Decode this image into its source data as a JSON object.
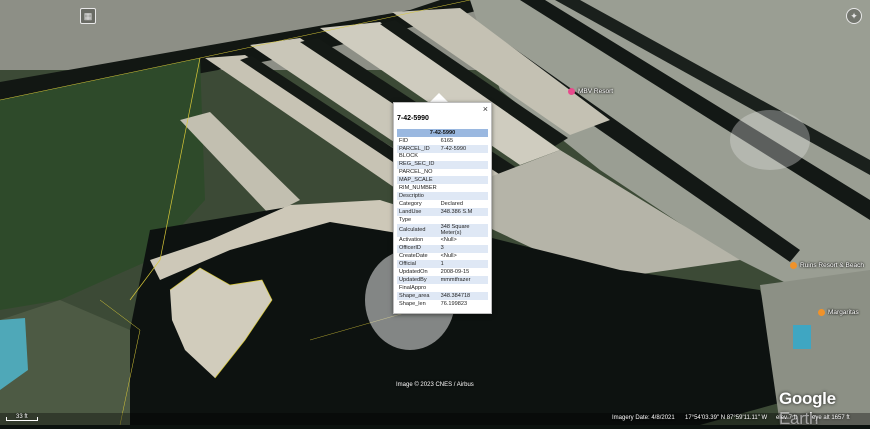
{
  "balloon": {
    "title": "7-42-5990",
    "table_header": "7-42-5990",
    "rows": [
      {
        "key": "FID",
        "value": "6165"
      },
      {
        "key": "PARCEL_ID",
        "value": "7-42-5990"
      },
      {
        "key": "BLOCK",
        "value": ""
      },
      {
        "key": "REG_SEC_ID",
        "value": ""
      },
      {
        "key": "PARCEL_NO",
        "value": ""
      },
      {
        "key": "MAP_SCALE",
        "value": ""
      },
      {
        "key": "RIM_NUMBER",
        "value": ""
      },
      {
        "key": "Descriptio",
        "value": ""
      },
      {
        "key": "Category",
        "value": "Declared"
      },
      {
        "key": "LandUse",
        "value": "348.386 S.M"
      },
      {
        "key": "Type",
        "value": ""
      },
      {
        "key": "Calculated",
        "value": "348 Square Meter(s)"
      },
      {
        "key": "Activation",
        "value": "<Null>"
      },
      {
        "key": "OfficerID",
        "value": "3"
      },
      {
        "key": "CreateDate",
        "value": "<Null>"
      },
      {
        "key": "Official",
        "value": "1"
      },
      {
        "key": "UpdatedOn",
        "value": "2008-09-15"
      },
      {
        "key": "UpdatedBy",
        "value": "mmmtfrazer"
      },
      {
        "key": "FinalAppro",
        "value": ""
      },
      {
        "key": "Shape_area",
        "value": "348.384718"
      },
      {
        "key": "Shape_len",
        "value": "76.199823"
      }
    ],
    "close_glyph": "×"
  },
  "map": {
    "place_labels": [
      {
        "text": "MBV Resort",
        "pin_color": "#e84a8c"
      },
      {
        "text": "Ruins Resort & Beach",
        "pin_color": "#f0922a"
      },
      {
        "text": "Margaritas",
        "pin_color": "#f0922a"
      }
    ],
    "attribution": "Image © 2023 CNES / Airbus",
    "logo_google": "Google",
    "logo_earth": " Earth"
  },
  "statusbar": {
    "scale": "33 ft",
    "imagery_date": "Imagery Date: 4/8/2021",
    "coordinates": "17°54'03.39\" N   87°59'11.11\" W",
    "elev": "elev   7 ft",
    "eye_alt": "eye alt  1657 ft"
  },
  "icons": {
    "layers": "layers-icon",
    "compass": "compass-icon"
  }
}
